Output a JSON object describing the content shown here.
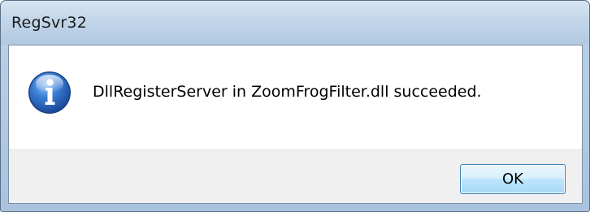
{
  "window": {
    "title": "RegSvr32"
  },
  "dialog": {
    "icon": "information-icon",
    "message": "DllRegisterServer in ZoomFrogFilter.dll succeeded.",
    "ok_label": "OK"
  },
  "colors": {
    "titlebar": "#c2d6ea",
    "icon_blue": "#2a63b8",
    "button_border": "#3c7fb1",
    "footer": "#f0f0f0"
  }
}
